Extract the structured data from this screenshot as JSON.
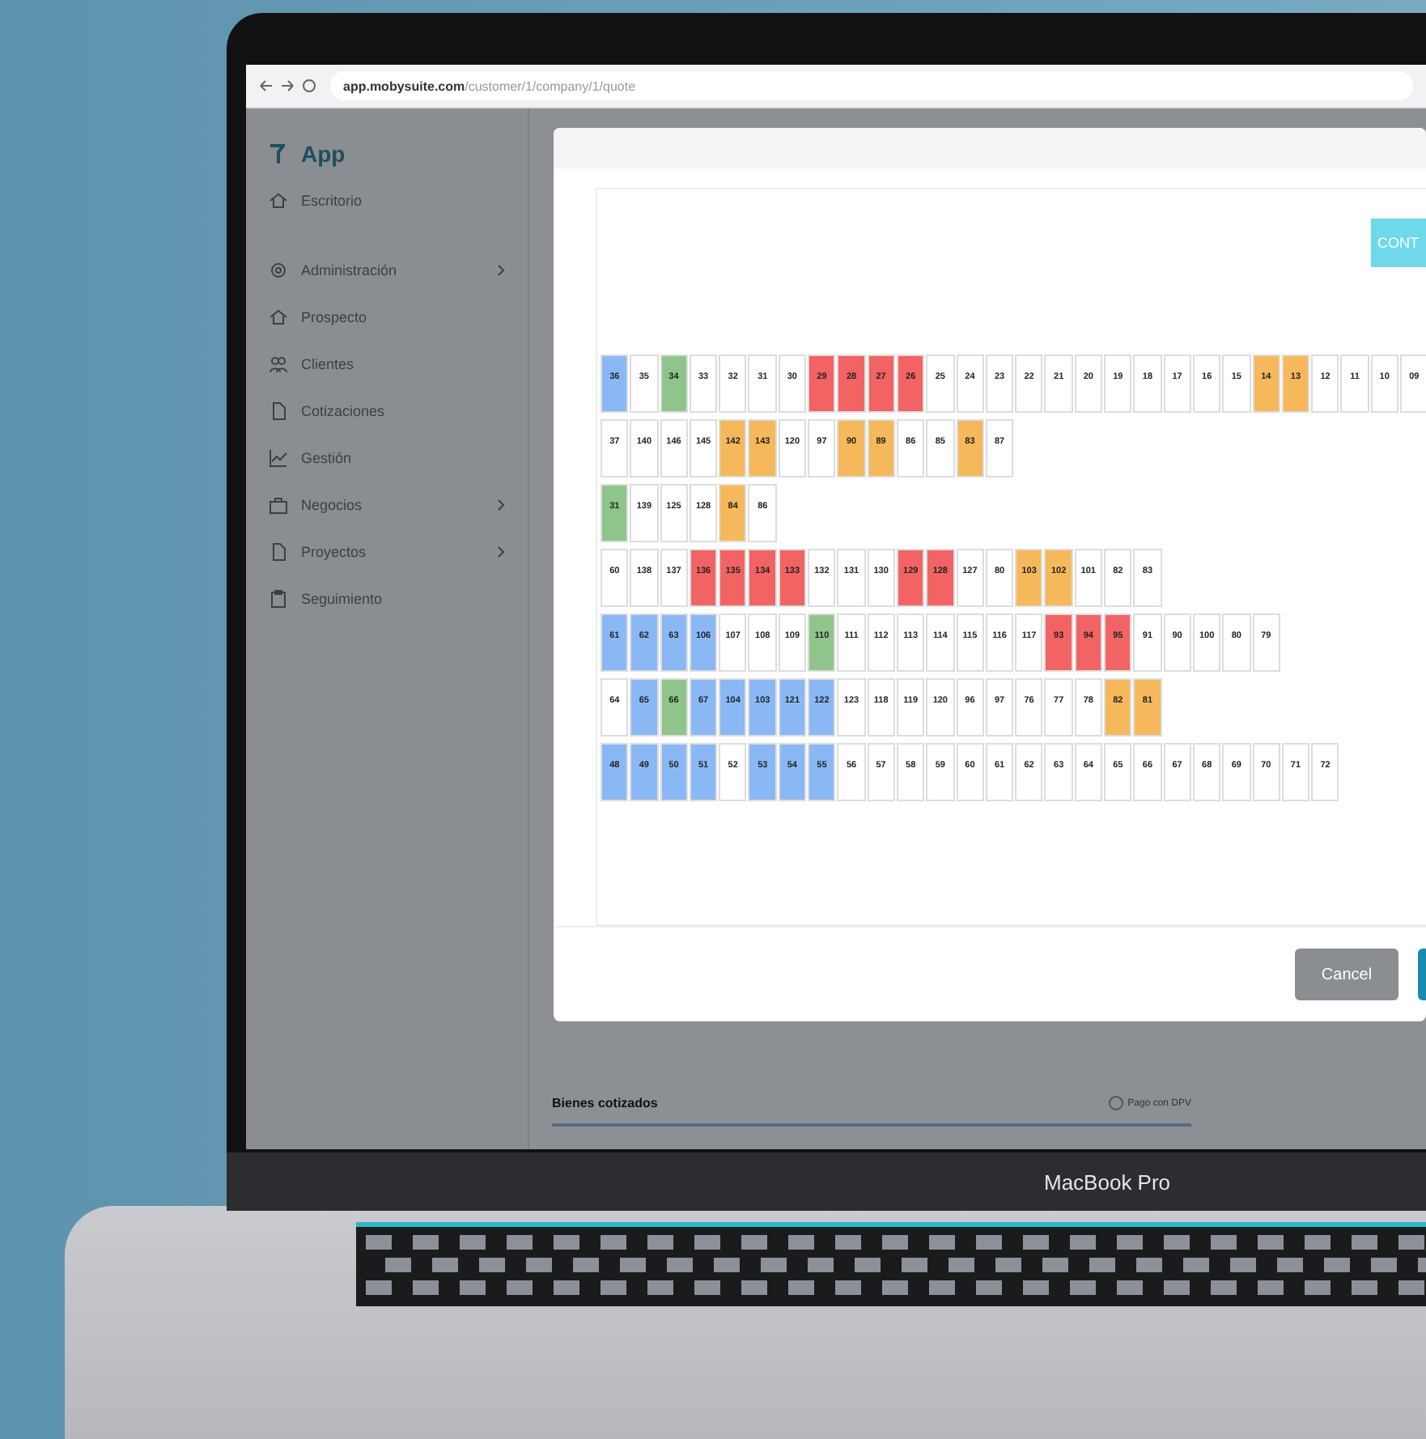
{
  "browser": {
    "url_host": "app.mobysuite.com",
    "url_path": "/customer/1/company/1/quote"
  },
  "sidebar": {
    "brand": "App",
    "items": [
      {
        "label": "Escritorio",
        "submenu": false
      },
      {
        "label": "Administración",
        "submenu": true
      },
      {
        "label": "Prospecto",
        "submenu": false
      },
      {
        "label": "Clientes",
        "submenu": false
      },
      {
        "label": "Cotizaciones",
        "submenu": false
      },
      {
        "label": "Gestión",
        "submenu": false
      },
      {
        "label": "Negocios",
        "submenu": true
      },
      {
        "label": "Proyectos",
        "submenu": true
      },
      {
        "label": "Seguimiento",
        "submenu": false
      }
    ]
  },
  "modal": {
    "top_button": "CONT",
    "lot_rows": [
      [
        {
          "label": "36",
          "color": "#8ab8f5"
        },
        {
          "label": "35"
        },
        {
          "label": "34",
          "color": "#8fc48a"
        },
        {
          "label": "33"
        },
        {
          "label": "32"
        },
        {
          "label": "31"
        },
        {
          "label": "30"
        },
        {
          "label": "29",
          "color": "#f26363"
        },
        {
          "label": "28",
          "color": "#f26363"
        },
        {
          "label": "27",
          "color": "#f26363"
        },
        {
          "label": "26",
          "color": "#f26363"
        },
        {
          "label": "25"
        },
        {
          "label": "24"
        },
        {
          "label": "23"
        },
        {
          "label": "22"
        },
        {
          "label": "21"
        },
        {
          "label": "20"
        },
        {
          "label": "19"
        },
        {
          "label": "18"
        },
        {
          "label": "17"
        },
        {
          "label": "16"
        },
        {
          "label": "15"
        },
        {
          "label": "14",
          "color": "#f5b95b"
        },
        {
          "label": "13",
          "color": "#f5b95b"
        },
        {
          "label": "12"
        },
        {
          "label": "11"
        },
        {
          "label": "10"
        },
        {
          "label": "09"
        }
      ],
      [
        {
          "label": "37"
        },
        {
          "label": "140"
        },
        {
          "label": "146"
        },
        {
          "label": "145"
        },
        {
          "label": "142",
          "color": "#f5b95b"
        },
        {
          "label": "143",
          "color": "#f5b95b"
        },
        {
          "label": "120"
        },
        {
          "label": "97"
        },
        {
          "label": "90",
          "color": "#f5b95b"
        },
        {
          "label": "89",
          "color": "#f5b95b"
        },
        {
          "label": "86"
        },
        {
          "label": "85"
        },
        {
          "label": "83",
          "color": "#f5b95b"
        },
        {
          "label": "87"
        }
      ],
      [
        {
          "label": "31",
          "color": "#8fc48a"
        },
        {
          "label": "139"
        },
        {
          "label": "125"
        },
        {
          "label": "128"
        },
        {
          "label": "84",
          "color": "#f5b95b"
        },
        {
          "label": "86"
        }
      ],
      [
        {
          "label": "60"
        },
        {
          "label": "138"
        },
        {
          "label": "137"
        },
        {
          "label": "136",
          "color": "#f26363"
        },
        {
          "label": "135",
          "color": "#f26363"
        },
        {
          "label": "134",
          "color": "#f26363"
        },
        {
          "label": "133",
          "color": "#f26363"
        },
        {
          "label": "132"
        },
        {
          "label": "131"
        },
        {
          "label": "130"
        },
        {
          "label": "129",
          "color": "#f26363"
        },
        {
          "label": "128",
          "color": "#f26363"
        },
        {
          "label": "127"
        },
        {
          "label": "80"
        },
        {
          "label": "103",
          "color": "#f5b95b"
        },
        {
          "label": "102",
          "color": "#f5b95b"
        },
        {
          "label": "101"
        },
        {
          "label": "82"
        },
        {
          "label": "83"
        }
      ],
      [
        {
          "label": "61",
          "color": "#8ab8f5"
        },
        {
          "label": "62",
          "color": "#8ab8f5"
        },
        {
          "label": "63",
          "color": "#8ab8f5"
        },
        {
          "label": "106",
          "color": "#8ab8f5"
        },
        {
          "label": "107"
        },
        {
          "label": "108"
        },
        {
          "label": "109"
        },
        {
          "label": "110",
          "color": "#8fc48a"
        },
        {
          "label": "111"
        },
        {
          "label": "112"
        },
        {
          "label": "113"
        },
        {
          "label": "114"
        },
        {
          "label": "115"
        },
        {
          "label": "116"
        },
        {
          "label": "117"
        },
        {
          "label": "93",
          "color": "#f26363"
        },
        {
          "label": "94",
          "color": "#f26363"
        },
        {
          "label": "95",
          "color": "#f26363"
        },
        {
          "label": "91"
        },
        {
          "label": "90"
        },
        {
          "label": "100"
        },
        {
          "label": "80"
        },
        {
          "label": "79"
        }
      ],
      [
        {
          "label": "64"
        },
        {
          "label": "65",
          "color": "#8ab8f5"
        },
        {
          "label": "66",
          "color": "#8fc48a"
        },
        {
          "label": "67",
          "color": "#8ab8f5"
        },
        {
          "label": "104",
          "color": "#8ab8f5"
        },
        {
          "label": "103",
          "color": "#8ab8f5"
        },
        {
          "label": "121",
          "color": "#8ab8f5"
        },
        {
          "label": "122",
          "color": "#8ab8f5"
        },
        {
          "label": "123"
        },
        {
          "label": "118"
        },
        {
          "label": "119"
        },
        {
          "label": "120"
        },
        {
          "label": "96"
        },
        {
          "label": "97"
        },
        {
          "label": "76"
        },
        {
          "label": "77"
        },
        {
          "label": "78"
        },
        {
          "label": "82",
          "color": "#f5b95b"
        },
        {
          "label": "81",
          "color": "#f5b95b"
        }
      ],
      [
        {
          "label": "48",
          "color": "#8ab8f5"
        },
        {
          "label": "49",
          "color": "#8ab8f5"
        },
        {
          "label": "50",
          "color": "#8ab8f5"
        },
        {
          "label": "51",
          "color": "#8ab8f5"
        },
        {
          "label": "52"
        },
        {
          "label": "53",
          "color": "#8ab8f5"
        },
        {
          "label": "54",
          "color": "#8ab8f5"
        },
        {
          "label": "55",
          "color": "#8ab8f5"
        },
        {
          "label": "56"
        },
        {
          "label": "57"
        },
        {
          "label": "58"
        },
        {
          "label": "59"
        },
        {
          "label": "60"
        },
        {
          "label": "61"
        },
        {
          "label": "62"
        },
        {
          "label": "63"
        },
        {
          "label": "64"
        },
        {
          "label": "65"
        },
        {
          "label": "66"
        },
        {
          "label": "67"
        },
        {
          "label": "68"
        },
        {
          "label": "69"
        },
        {
          "label": "70"
        },
        {
          "label": "71"
        },
        {
          "label": "72"
        }
      ]
    ],
    "buttons": [
      {
        "label": "Cancel",
        "kind": "secondary"
      },
      {
        "kind": "primary"
      }
    ]
  },
  "page": {
    "section_title": "Bienes cotizados",
    "checkbox": {
      "label": "Pago con DPV",
      "checked": false
    }
  },
  "device": {
    "label": "MacBook Pro"
  }
}
